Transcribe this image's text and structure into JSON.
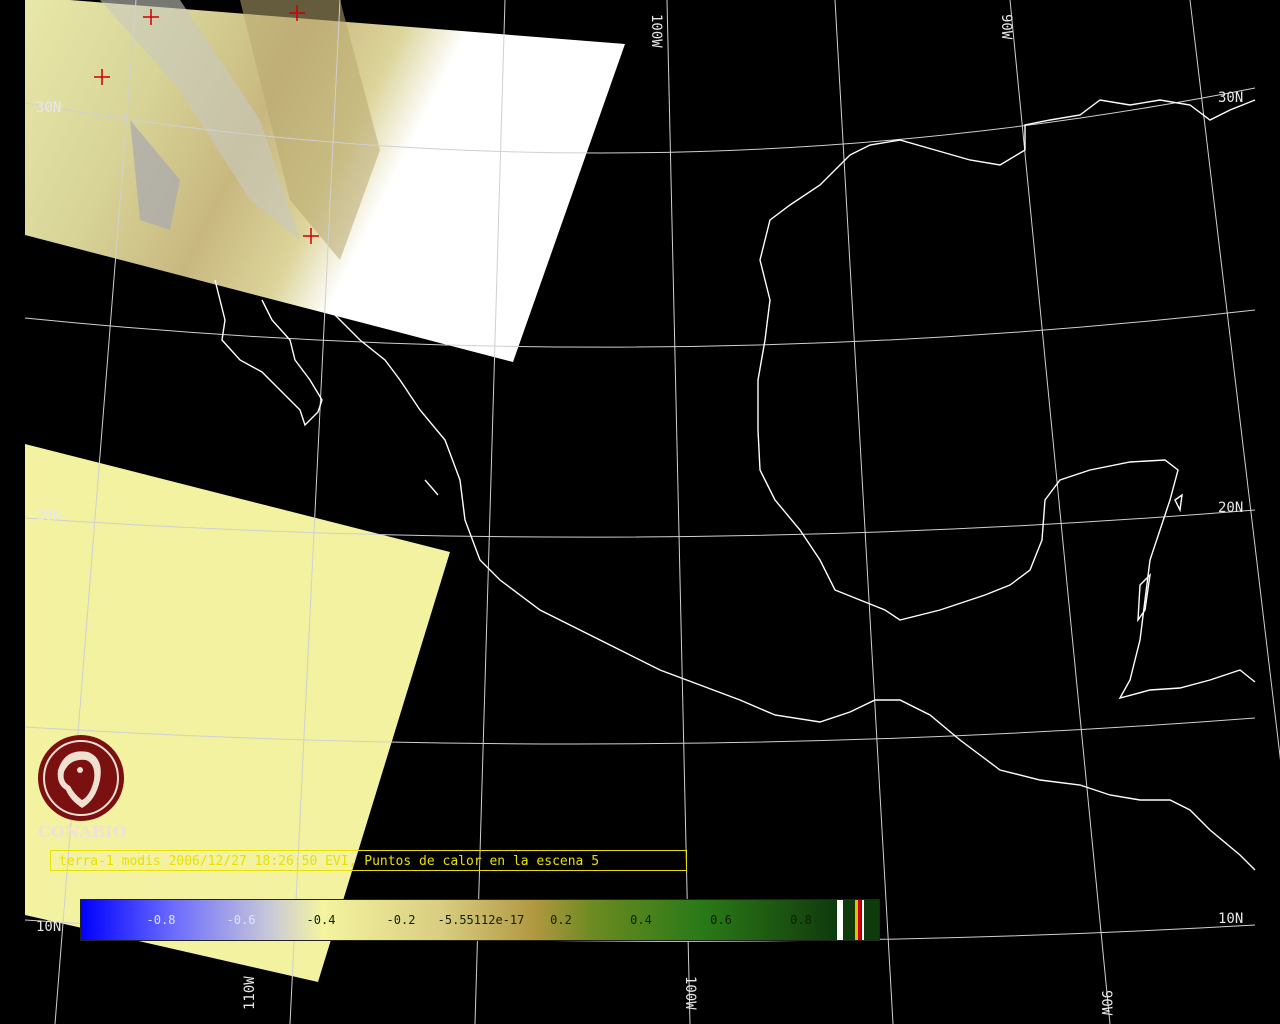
{
  "caption": "terra-1 modis 2006/12/27 18:26:50 EVI, Puntos de calor en la escena 5",
  "logo": {
    "name": "CONABIO",
    "icon": "conabio-macaw-logo-icon"
  },
  "grid_labels": {
    "lat_30": "30N",
    "lat_20": "20N",
    "lat_10": "10N",
    "lon_100": "100W",
    "lon_90": "90W",
    "lon_110": "110W"
  },
  "colorbar": {
    "labels": [
      "-0.8",
      "-0.6",
      "-0.4",
      "-0.2",
      "-5.55112e-17",
      "0.2",
      "0.4",
      "0.6",
      "0.8"
    ],
    "colors": {
      "negative": "#1010ff",
      "neutral": "#f0f0a0",
      "low_veg": "#a89040",
      "high_veg": "#1a5a10"
    }
  },
  "colors": {
    "background": "#000000",
    "coastline": "#ffffff",
    "grid": "#d0d0d0",
    "swath_yellow": "#f0f0a0",
    "caption": "#e8e000",
    "hotspot_marker": "#cc0000",
    "logo": "#7a1010"
  }
}
